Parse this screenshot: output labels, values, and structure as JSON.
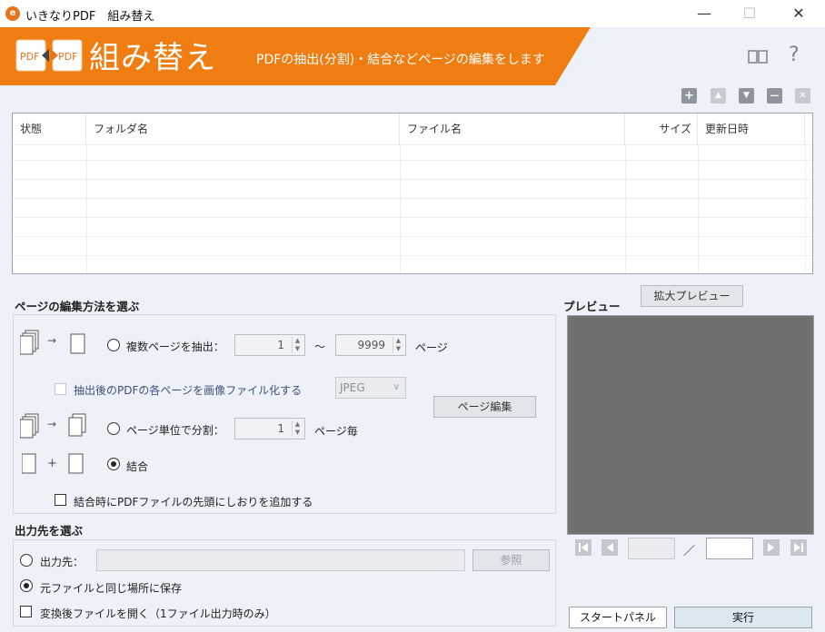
{
  "window": {
    "title": "いきなりPDF　組み替え",
    "minimize": "—",
    "maximize": "☐",
    "close": "✕"
  },
  "header": {
    "icon_left_text": "PDF",
    "icon_right_text": "PDF",
    "title": "組み替え",
    "subtitle": "PDFの抽出(分割)・結合などページの編集をします",
    "help": "?"
  },
  "toolbar": {
    "add": "+",
    "up": "▲",
    "down": "▼",
    "remove": "—",
    "clear": "✕"
  },
  "file_table": {
    "columns": [
      "状態",
      "フォルダ名",
      "ファイル名",
      "サイズ",
      "更新日時"
    ],
    "rows": []
  },
  "edit_section": {
    "title": "ページの編集方法を選ぶ",
    "extract_label": "複数ページを抽出：",
    "extract_from": "1",
    "tilde": "～",
    "extract_to": "9999",
    "page_unit": "ページ",
    "image_checkbox_label": "抽出後のPDFの各ページを画像ファイル化する",
    "image_format": "JPEG",
    "page_edit_button": "ページ編集",
    "split_label": "ページ単位で分割：",
    "split_value": "1",
    "split_unit": "ページ毎",
    "merge_label": "結合",
    "merge_bookmark_label": "結合時にPDFファイルの先頭にしおりを追加する",
    "arrow": "→",
    "plus": "+"
  },
  "output_section": {
    "title": "出力先を選ぶ",
    "output_label": "出力先：",
    "output_value": "",
    "browse_button": "参照",
    "same_place_label": "元ファイルと同じ場所に保存",
    "open_after_label": "変換後ファイルを開く（1ファイル出力時のみ）"
  },
  "preview": {
    "title": "プレビュー",
    "zoom_button": "拡大プレビュー",
    "current_page": "",
    "separator": "／",
    "total_pages": ""
  },
  "footer": {
    "start_panel_button": "スタートパネル",
    "run_button": "実行"
  },
  "selected_mode": "merge",
  "colors": {
    "accent": "#ef7d12",
    "background": "#eef2f8"
  }
}
